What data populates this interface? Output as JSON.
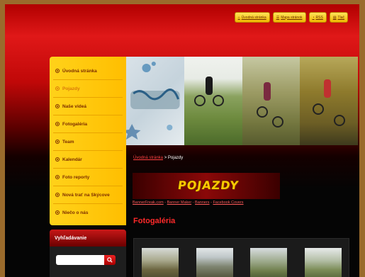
{
  "top_nav": [
    {
      "label": "Úvodná stránka",
      "icon": "home-icon"
    },
    {
      "label": "Mapa stránok",
      "icon": "sitemap-icon"
    },
    {
      "label": "RSS",
      "icon": "rss-icon"
    },
    {
      "label": "Tlač",
      "icon": "print-icon"
    }
  ],
  "sidebar": {
    "items": [
      {
        "label": "Úvodná stránka"
      },
      {
        "label": "Pojazdy"
      },
      {
        "label": "Naše videá"
      },
      {
        "label": "Fotogaléria"
      },
      {
        "label": "Team"
      },
      {
        "label": "Kalendár"
      },
      {
        "label": "Foto reporty"
      },
      {
        "label": "Nová trať na Skýcove"
      },
      {
        "label": "Niečo o nás"
      }
    ],
    "active_index": 1
  },
  "search": {
    "title": "Vyhľadávanie",
    "placeholder": "",
    "button_icon": "search-icon"
  },
  "breadcrumb": {
    "home": "Úvodná stránka",
    "separator": ">",
    "current": "Pojazdy"
  },
  "logo_text": "POJAZDY",
  "links": [
    "BannerFreak.com",
    "Banner Maker",
    "Banners",
    "Facebook Covers"
  ],
  "content": {
    "heading": "Fotogaléria"
  },
  "colors": {
    "accent": "#ffc400",
    "brand_red": "#e01818",
    "link": "#ff4040"
  }
}
